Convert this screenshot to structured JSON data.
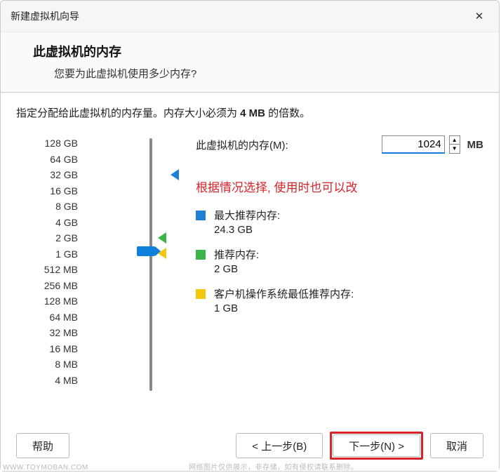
{
  "window": {
    "title": "新建虚拟机向导"
  },
  "header": {
    "title": "此虚拟机的内存",
    "subtitle": "您要为此虚拟机使用多少内存?"
  },
  "desc": {
    "prefix": "指定分配给此虚拟机的内存量。内存大小必须为 ",
    "bold": "4 MB",
    "suffix": " 的倍数。"
  },
  "scale": [
    "128 GB",
    "64 GB",
    "32 GB",
    "16 GB",
    "8 GB",
    "4 GB",
    "2 GB",
    "1 GB",
    "512 MB",
    "256 MB",
    "128 MB",
    "64 MB",
    "32 MB",
    "16 MB",
    "8 MB",
    "4 MB"
  ],
  "memory": {
    "label": "此虚拟机的内存(M):",
    "value": "1024",
    "unit": "MB"
  },
  "annotation": "根据情况选择, 使用时也可以改",
  "recommendations": {
    "max_label": "最大推荐内存:",
    "max_value": "24.3 GB",
    "rec_label": "推荐内存:",
    "rec_value": "2 GB",
    "min_label": "客户机操作系统最低推荐内存:",
    "min_value": "1 GB"
  },
  "buttons": {
    "help": "帮助",
    "back": "< 上一步(B)",
    "next": "下一步(N) >",
    "cancel": "取消"
  },
  "watermark": {
    "site": "WWW.TOYMOBAN.COM",
    "note": "网络图片仅供展示，非存储，如有侵权请联系删除。"
  }
}
